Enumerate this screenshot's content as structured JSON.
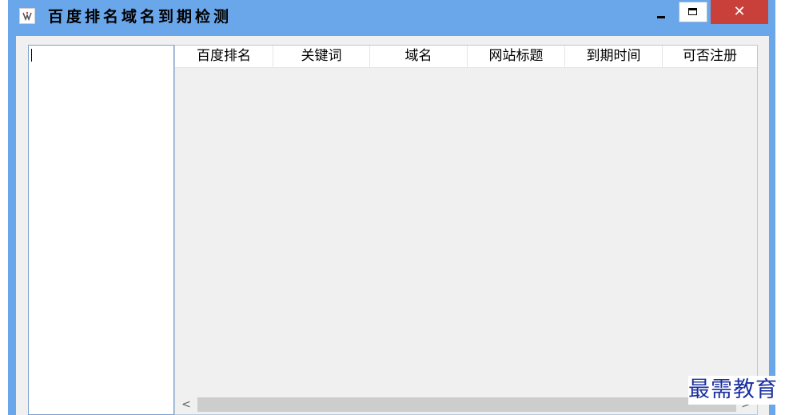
{
  "window": {
    "title": "百度排名域名到期检测",
    "icon": "app-logo-icon",
    "controls": {
      "minimize_label": "–",
      "maximize_label": "",
      "close_label": "✕"
    },
    "colors": {
      "frame": "#6aa6ea",
      "close_button": "#c9403a",
      "client_background": "#f0f0f0"
    }
  },
  "input_panel": {
    "value": ""
  },
  "table": {
    "columns": [
      "百度排名",
      "关键词",
      "域名",
      "网站标题",
      "到期时间",
      "可否注册"
    ],
    "rows": []
  },
  "scrollbar": {
    "left_arrow": "<",
    "right_arrow": ">"
  },
  "watermark": {
    "text": "最需教育"
  }
}
